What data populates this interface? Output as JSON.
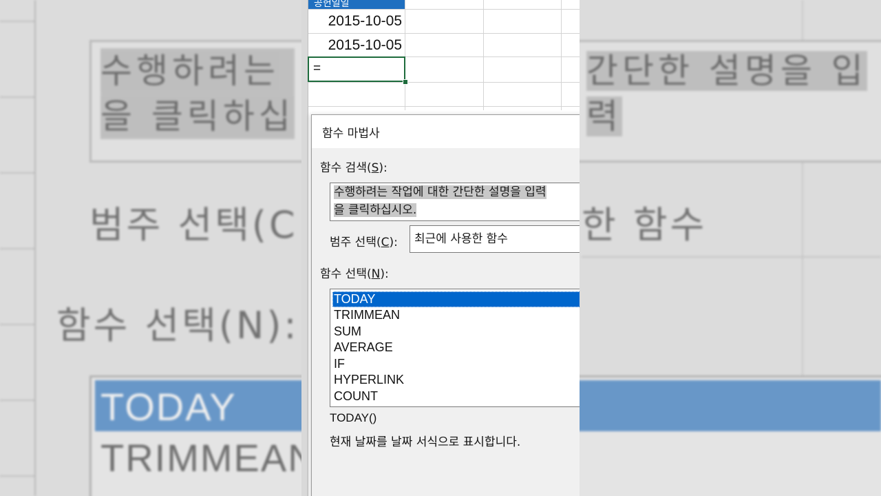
{
  "sheet": {
    "header_text": "공헌일일",
    "dates": [
      "2015-10-05",
      "2015-10-05"
    ],
    "active_cell_value": "="
  },
  "dialog": {
    "title": "함수 마법사",
    "search_label": "함수 검색(",
    "search_key": "S",
    "search_label_end": "):",
    "search_text": "수행하려는 작업에 대한 간단한 설명을 입력\n을 클릭하십시오.",
    "category_label": "범주 선택(",
    "category_key": "C",
    "category_label_end": "):",
    "category_value": "최근에 사용한 함수",
    "function_label": "함수 선택(",
    "function_key": "N",
    "function_label_end": "):",
    "functions": [
      "TODAY",
      "TRIMMEAN",
      "SUM",
      "AVERAGE",
      "IF",
      "HYPERLINK",
      "COUNT"
    ],
    "selected_function": "TODAY",
    "signature": "TODAY()",
    "description": "현재 날짜를 날짜 서식으로 표시합니다."
  },
  "background": {
    "desc_line1": "수행하려는",
    "desc_line1_right": "간단한 설명을 입력",
    "desc_line2": "을 클릭하십",
    "category_label": "범주 선택(C",
    "category_value_tail": "한 함수",
    "function_label": "함수 선택(N):",
    "list_first": "TODAY",
    "list_second": "TRIMMEAN"
  }
}
